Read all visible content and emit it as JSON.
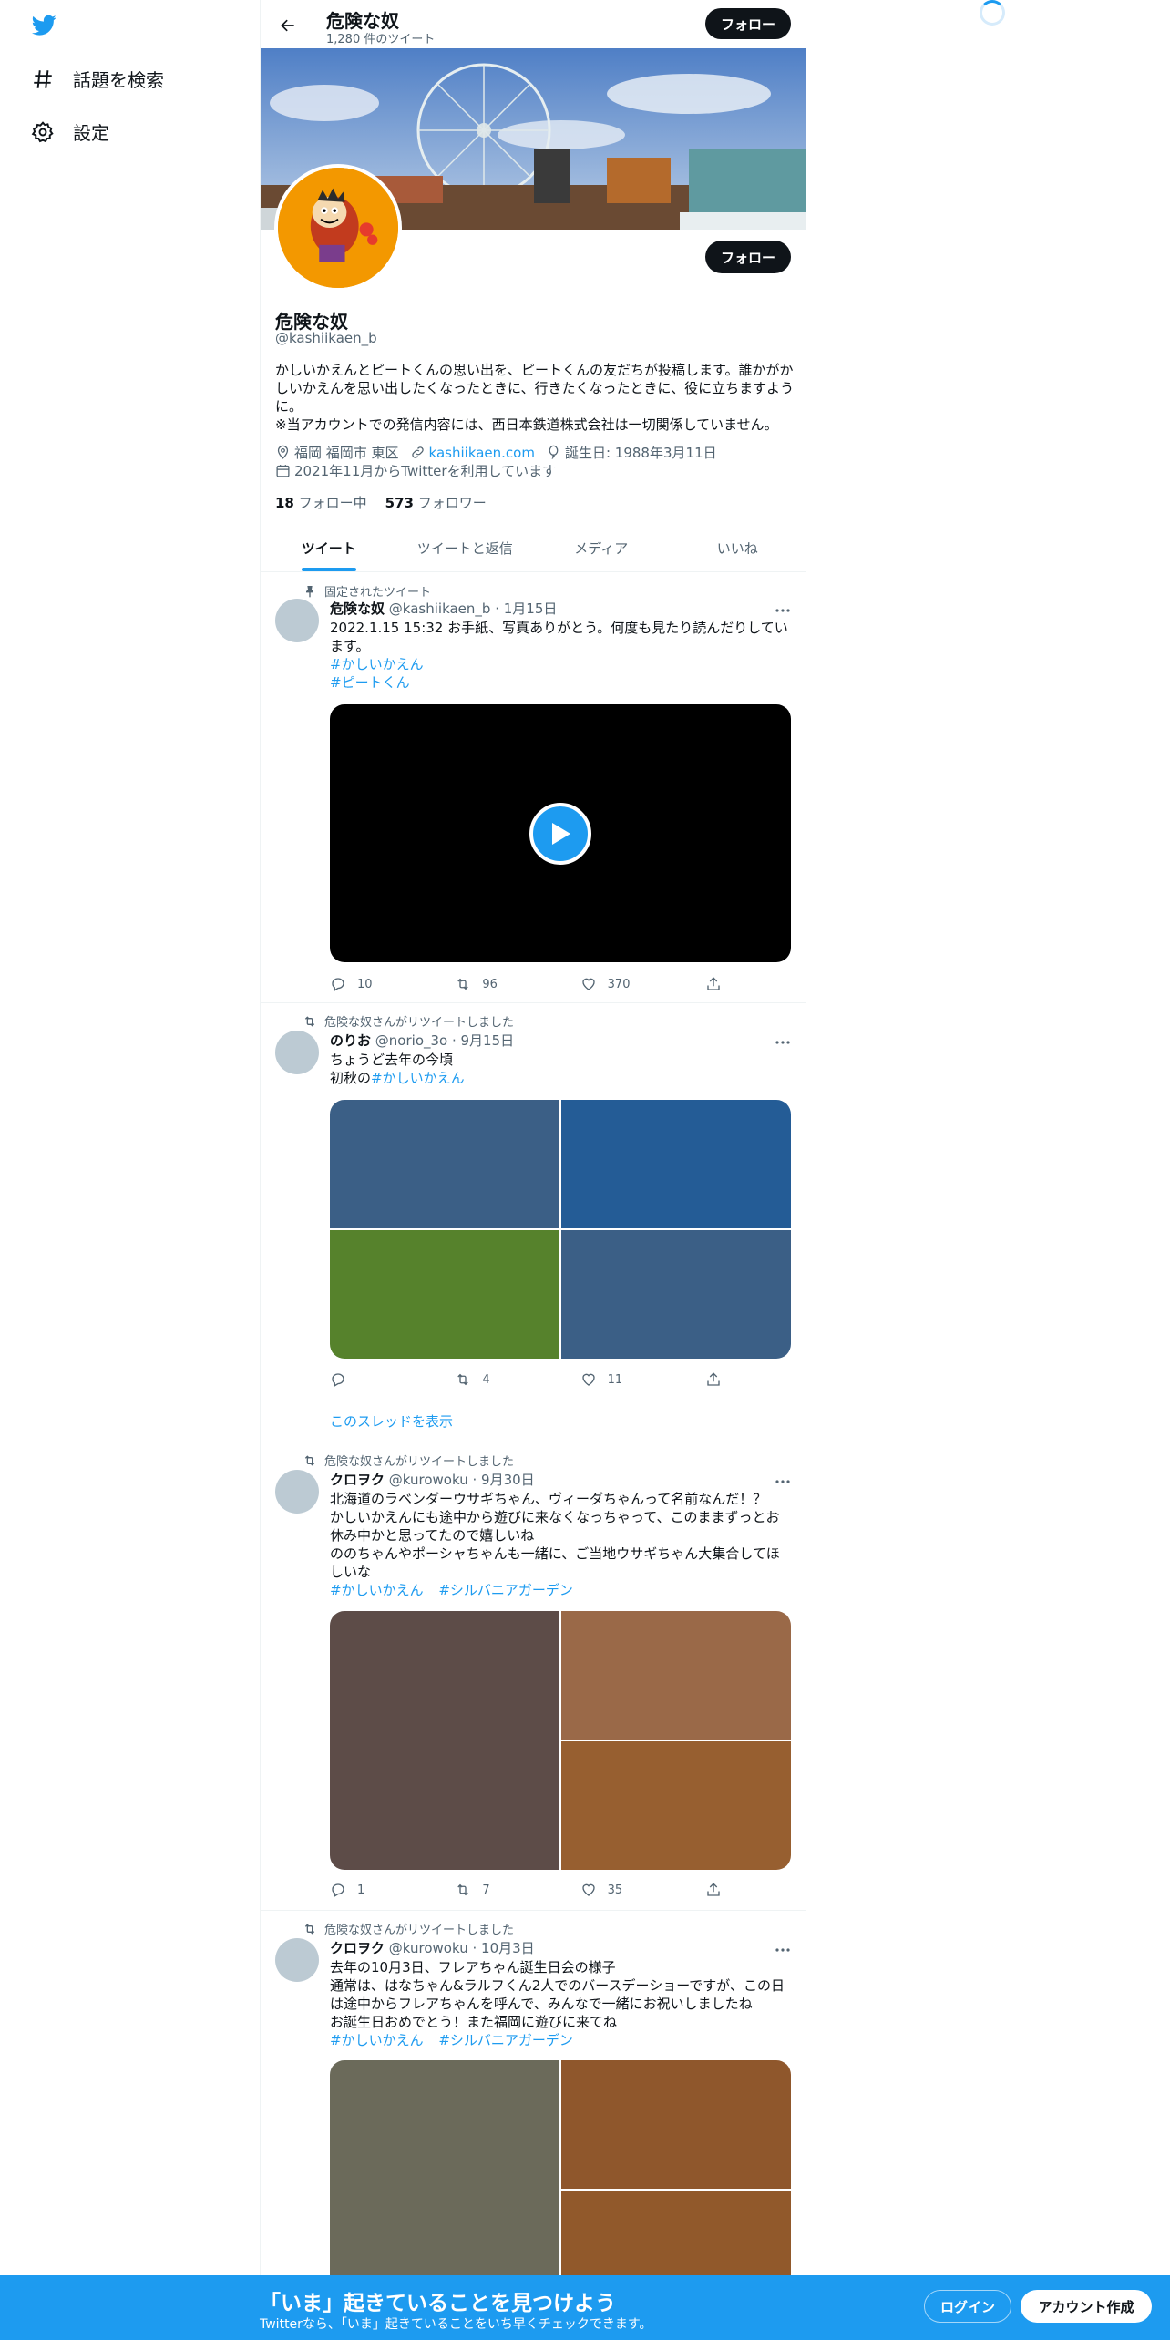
{
  "nav": {
    "explore_label": "話題を検索",
    "settings_label": "設定"
  },
  "topbar": {
    "name": "危険な奴",
    "tweet_count": "1,280 件のツイート",
    "follow_label": "フォロー"
  },
  "profile": {
    "name": "危険な奴",
    "handle": "@kashiikaen_b",
    "follow_label": "フォロー",
    "bio": "かしいかえんとピートくんの思い出を、ピートくんの友だちが投稿します。誰かがかしいかえんを思い出したくなったときに、行きたくなったときに、役に立ちますように。\n※当アカウントでの発信内容には、西日本鉄道株式会社は一切関係していません。",
    "location": "福岡 福岡市 東区",
    "website": "kashiikaen.com",
    "birthday": "誕生日: 1988年3月11日",
    "joined": "2021年11月からTwitterを利用しています",
    "following_count": "18",
    "following_label": "フォロー中",
    "followers_count": "573",
    "followers_label": "フォロワー"
  },
  "tabs": [
    "ツイート",
    "ツイートと返信",
    "メディア",
    "いいね"
  ],
  "tweets": [
    {
      "social": "固定されたツイート",
      "name": "危険な奴",
      "meta": "@kashiikaen_b · 1月15日",
      "text": "2022.1.15 15:32 お手紙、写真ありがとう。何度も見たり読んだりしています。",
      "hashtags": [
        "#かしいかえん",
        "#ピートくん"
      ],
      "replies": "10",
      "retweets": "96",
      "likes": "370"
    },
    {
      "social": "危険な奴さんがリツイートしました",
      "name": "のりお",
      "meta": "@norio_3o · 9月15日",
      "text": "ちょうど去年の今頃\n初秋の",
      "inline_hashtag": "#かしいかえん",
      "replies": "",
      "retweets": "4",
      "likes": "11",
      "thread_link": "このスレッドを表示"
    },
    {
      "social": "危険な奴さんがリツイートしました",
      "name": "クロヲク",
      "meta": "@kurowoku · 9月30日",
      "text": "北海道のラベンダーウサギちゃん、ヴィーダちゃんって名前なんだ！？\nかしいかえんにも途中から遊びに来なくなっちゃって、このままずっとお休み中かと思ってたので嬉しいね\nののちゃんやポーシャちゃんも一緒に、ご当地ウサギちゃん大集合してほしいな",
      "hashtags": [
        "#かしいかえん",
        "#シルバニアガーデン"
      ],
      "replies": "1",
      "retweets": "7",
      "likes": "35"
    },
    {
      "social": "危険な奴さんがリツイートしました",
      "name": "クロヲク",
      "meta": "@kurowoku · 10月3日",
      "text": "去年の10月3日、フレアちゃん誕生日会の様子\n通常は、はなちゃん&ラルフくん2人でのバースデーショーですが、この日は途中からフレアちゃんを呼んで、みんなで一緒にお祝いしましたね\nお誕生日おめでとう！また福岡に遊びに来てね",
      "hashtags": [
        "#かしいかえん",
        "#シルバニアガーデン"
      ]
    }
  ],
  "bottombar": {
    "title": "「いま」起きていることを見つけよう",
    "subtitle": "Twitterなら、「いま」起きていることをいち早くチェックできます。",
    "login_label": "ログイン",
    "signup_label": "アカウント作成"
  },
  "colors": {
    "accent": "#1d9bf0",
    "text": "#0f1419",
    "secondary": "#536471",
    "grid_blue_1": "#3b5f86",
    "grid_blue_2": "#245c96",
    "grid_green": "#56822c",
    "grid_brown_dark": "#5d4c48",
    "grid_brown_1": "#9a6948",
    "grid_brown_2": "#975f30",
    "grid_olive": "#6b6a5a",
    "grid_brown_3": "#8f572c",
    "grid_brown_4": "#91592b"
  }
}
